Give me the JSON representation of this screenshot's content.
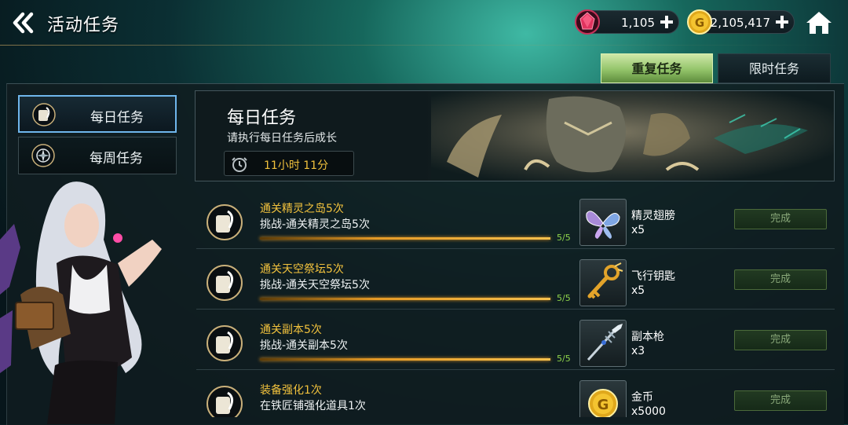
{
  "header": {
    "title": "活动任务",
    "back_icon": "double-chevron-left-icon",
    "home_icon": "home-icon"
  },
  "currencies": {
    "gems": {
      "icon": "red-gem-icon",
      "value": "1,105"
    },
    "gold": {
      "icon": "gold-coin-icon",
      "value": "2,105,417"
    }
  },
  "tabs": [
    {
      "label": "重复任务",
      "active": true
    },
    {
      "label": "限时任务",
      "active": false
    }
  ],
  "sidebar": {
    "items": [
      {
        "label": "每日任务",
        "icon": "scroll-quill-icon",
        "active": true
      },
      {
        "label": "每周任务",
        "icon": "compass-icon",
        "active": false
      }
    ]
  },
  "banner": {
    "title": "每日任务",
    "subtitle": "请执行每日任务后成长",
    "timer": "11小时 11分",
    "timer_icon": "clock-icon"
  },
  "tasks": [
    {
      "name": "通关精灵之岛5次",
      "desc": "挑战-通关精灵之岛5次",
      "progress": "5/5",
      "progress_ratio": 1.0,
      "reward_name": "精灵翅膀",
      "reward_qty": "x5",
      "reward_icon": "butterfly-wings-icon",
      "button": "完成"
    },
    {
      "name": "通关天空祭坛5次",
      "desc": "挑战-通关天空祭坛5次",
      "progress": "5/5",
      "progress_ratio": 1.0,
      "reward_name": "飞行钥匙",
      "reward_qty": "x5",
      "reward_icon": "golden-key-icon",
      "button": "完成"
    },
    {
      "name": "通关副本5次",
      "desc": "挑战-通关副本5次",
      "progress": "5/5",
      "progress_ratio": 1.0,
      "reward_name": "副本枪",
      "reward_qty": "x3",
      "reward_icon": "spear-icon",
      "button": "完成"
    },
    {
      "name": "装备强化1次",
      "desc": "在铁匠铺强化道具1次",
      "progress": "",
      "progress_ratio": 1.0,
      "reward_name": "金币",
      "reward_qty": "x5000",
      "reward_icon": "gold-coin-icon",
      "button": "完成"
    }
  ],
  "colors": {
    "accent_gold": "#f2c23d",
    "progress_green": "#8fd44a",
    "active_tab": "#93c46a",
    "active_sidebar_border": "#6fb6ec"
  }
}
